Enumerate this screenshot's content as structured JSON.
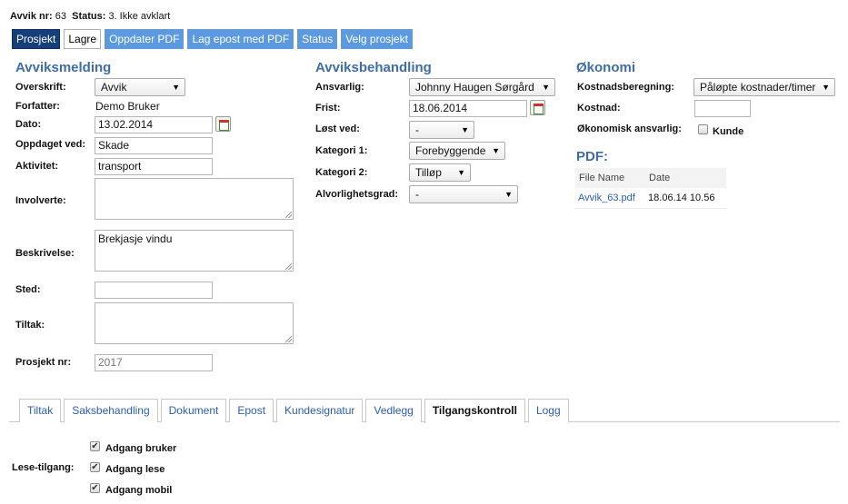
{
  "header": {
    "avvik_nr_label": "Avvik nr:",
    "avvik_nr_value": "63",
    "status_label": "Status:",
    "status_value": "3. Ikke avklart"
  },
  "toolbar": [
    {
      "label": "Prosjekt"
    },
    {
      "label": "Lagre"
    },
    {
      "label": "Oppdater PDF"
    },
    {
      "label": "Lag epost med PDF"
    },
    {
      "label": "Status"
    },
    {
      "label": "Velg prosjekt"
    }
  ],
  "avviksmelding": {
    "title": "Avviksmelding",
    "overskrift_label": "Overskrift:",
    "overskrift_value": "Avvik",
    "forfatter_label": "Forfatter:",
    "forfatter_value": "Demo Bruker",
    "dato_label": "Dato:",
    "dato_value": "13.02.2014",
    "oppdaget_label": "Oppdaget ved:",
    "oppdaget_value": "Skade",
    "aktivitet_label": "Aktivitet:",
    "aktivitet_value": "transport",
    "involverte_label": "Involverte:",
    "involverte_value": "",
    "beskrivelse_label": "Beskrivelse:",
    "beskrivelse_value": "Brekjasje vindu",
    "sted_label": "Sted:",
    "sted_value": "",
    "tiltak_label": "Tiltak:",
    "tiltak_value": "",
    "prosjekt_label": "Prosjekt nr:",
    "prosjekt_value": "2017"
  },
  "avviksbehandling": {
    "title": "Avviksbehandling",
    "ansvarlig_label": "Ansvarlig:",
    "ansvarlig_value": "Johnny Haugen Sørgård",
    "frist_label": "Frist:",
    "frist_value": "18.06.2014",
    "lost_ved_label": "Løst ved:",
    "lost_ved_value": "-",
    "kategori1_label": "Kategori 1:",
    "kategori1_value": "Forebyggende",
    "kategori2_label": "Kategori 2:",
    "kategori2_value": "Tilløp",
    "alvorlighet_label": "Alvorlighetsgrad:",
    "alvorlighet_value": "-"
  },
  "okonomi": {
    "title": "Økonomi",
    "kostnadsberegning_label": "Kostnadsberegning:",
    "kostnadsberegning_value": "Påløpte kostnader/timer",
    "kostnad_label": "Kostnad:",
    "kostnad_value": "",
    "ansvarlig_label": "Økonomisk ansvarlig:",
    "kunde_label": "Kunde",
    "kunde_checked": false
  },
  "pdf": {
    "title": "PDF:",
    "columns": [
      "File Name",
      "Date"
    ],
    "rows": [
      {
        "file": "Avvik_63.pdf",
        "date": "18.06.14 10.56"
      }
    ]
  },
  "tabs": [
    {
      "label": "Tiltak",
      "active": false
    },
    {
      "label": "Saksbehandling",
      "active": false
    },
    {
      "label": "Dokument",
      "active": false
    },
    {
      "label": "Epost",
      "active": false
    },
    {
      "label": "Kundesignatur",
      "active": false
    },
    {
      "label": "Vedlegg",
      "active": false
    },
    {
      "label": "Tilgangskontroll",
      "active": true
    },
    {
      "label": "Logg",
      "active": false
    }
  ],
  "tilgang": {
    "lese_label": "Lese-tilgang:",
    "items": [
      {
        "label": "Adgang bruker",
        "checked": true
      },
      {
        "label": "Adgang lese",
        "checked": true
      },
      {
        "label": "Adgang mobil",
        "checked": true
      }
    ]
  }
}
